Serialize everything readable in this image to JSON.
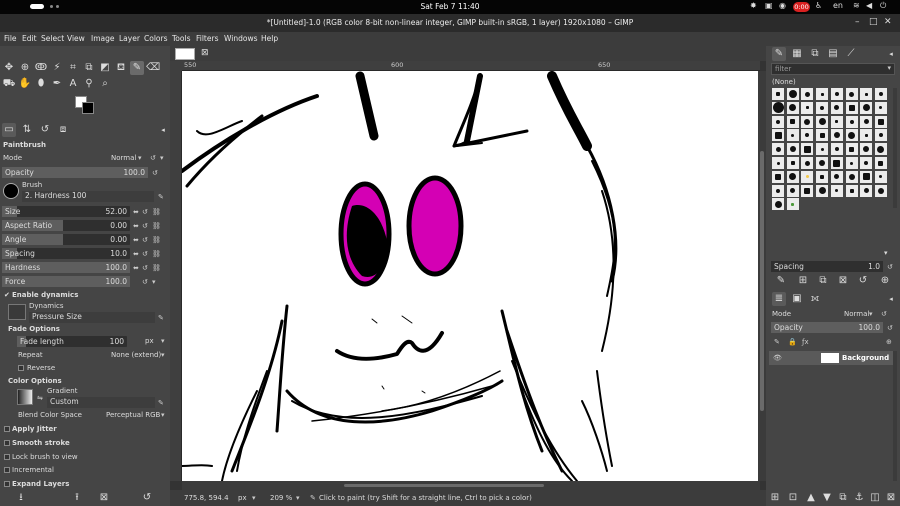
{
  "topbar": {
    "clock": "Sat Feb 7  11:40",
    "rec": "0:00",
    "lang": "en"
  },
  "window": {
    "title": "*[Untitled]-1.0 (RGB color 8-bit non-linear integer, GIMP built-in sRGB, 1 layer) 1920x1080 – GIMP"
  },
  "menu": [
    "File",
    "Edit",
    "Select",
    "View",
    "Image",
    "Layer",
    "Colors",
    "Tools",
    "Filters",
    "Windows",
    "Help"
  ],
  "tool_options": {
    "title": "Paintbrush",
    "mode_label": "Mode",
    "mode_value": "Normal",
    "opacity_label": "Opacity",
    "opacity_value": "100.0",
    "brush_label": "Brush",
    "brush_value": "2. Hardness 100",
    "size_label": "Size",
    "size_value": "52.00",
    "aspect_label": "Aspect Ratio",
    "aspect_value": "0.00",
    "angle_label": "Angle",
    "angle_value": "0.00",
    "spacing_label": "Spacing",
    "spacing_value": "10.0",
    "hardness_label": "Hardness",
    "hardness_value": "100.0",
    "force_label": "Force",
    "force_value": "100.0",
    "enable_dynamics": "Enable dynamics",
    "dynamics_label": "Dynamics",
    "dynamics_value": "Pressure Size",
    "fade_options": "Fade Options",
    "fade_length_label": "Fade length",
    "fade_length_value": "100",
    "fade_unit": "px",
    "repeat_label": "Repeat",
    "repeat_value": "None (extend)",
    "reverse": "Reverse",
    "color_options": "Color Options",
    "gradient_label": "Gradient",
    "gradient_value": "Custom",
    "blend_label": "Blend Color Space",
    "blend_value": "Perceptual RGB",
    "apply_jitter": "Apply Jitter",
    "smooth_stroke": "Smooth stroke",
    "lock_brush": "Lock brush to view",
    "incremental": "Incremental",
    "expand_layers": "Expand Layers"
  },
  "ruler": {
    "h0": "550",
    "h1": "600",
    "h2": "650"
  },
  "status": {
    "coords": "775.8, 594.4",
    "unit": "px",
    "zoom": "209 %",
    "message": "Click to paint (try Shift for a straight line, Ctrl to pick a color)"
  },
  "right": {
    "filter_placeholder": "filter",
    "none_label": "(None)",
    "spacing_label": "Spacing",
    "spacing_value": "1.0",
    "layers_mode_label": "Mode",
    "layers_mode_value": "Normal",
    "layers_opacity_label": "Opacity",
    "layers_opacity_value": "100.0",
    "layer_name": "Background"
  },
  "colors": {
    "accent": "#d400b4"
  }
}
